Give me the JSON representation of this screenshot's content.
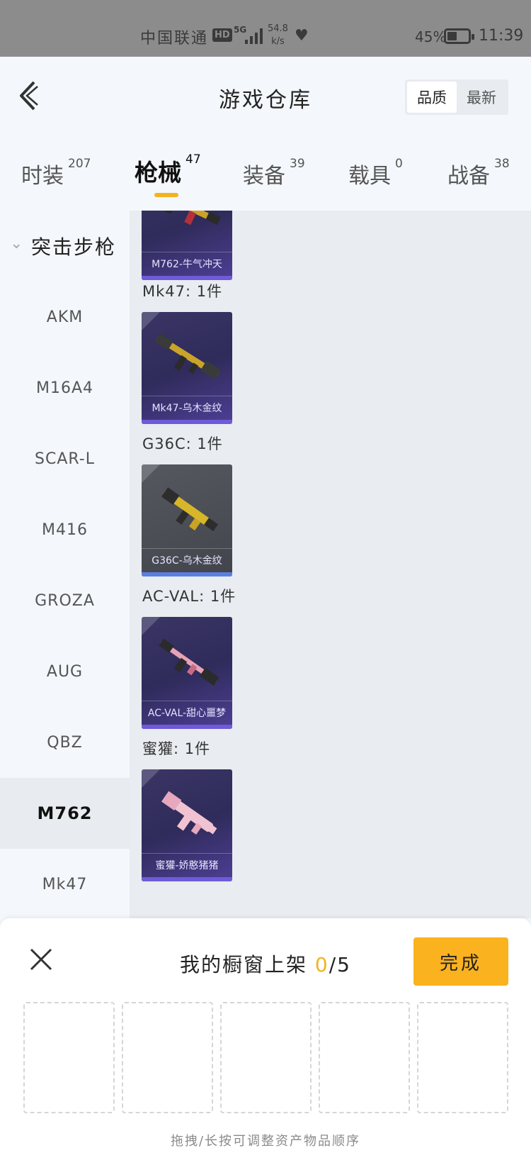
{
  "status_bar": {
    "carrier": "中国联通",
    "hd": "HD",
    "network": "5G",
    "speed_value": "54.8",
    "speed_unit": "k/s",
    "battery": "45%",
    "time": "11:39"
  },
  "header": {
    "title": "游戏仓库",
    "sort_options": [
      "品质",
      "最新"
    ],
    "sort_active": "品质"
  },
  "tabs": [
    {
      "label": "时装",
      "count": "207"
    },
    {
      "label": "枪械",
      "count": "47"
    },
    {
      "label": "装备",
      "count": "39"
    },
    {
      "label": "载具",
      "count": "0"
    },
    {
      "label": "战备",
      "count": "38"
    }
  ],
  "active_tab": "枪械",
  "sidebar": {
    "group_label": "突击步枪",
    "items": [
      "AKM",
      "M16A4",
      "SCAR-L",
      "M416",
      "GROZA",
      "AUG",
      "QBZ",
      "M762",
      "Mk47"
    ],
    "active_item": "M762"
  },
  "content": {
    "top_card": {
      "caption": "M762-牛气冲天",
      "color": "purple"
    },
    "groups": [
      {
        "label": "Mk47: 1件",
        "caption": "Mk47-乌木金纹",
        "color": "purple"
      },
      {
        "label": "G36C: 1件",
        "caption": "G36C-乌木金纹",
        "color": "grey"
      },
      {
        "label": "AC-VAL: 1件",
        "caption": "AC-VAL-甜心噩梦",
        "color": "purple"
      },
      {
        "label": "蜜獾: 1件",
        "caption": "蜜獾-娇憨猪猪",
        "color": "purple"
      }
    ]
  },
  "panel": {
    "title_text": "我的橱窗上架",
    "current": "0",
    "total": "/5",
    "done_label": "完成",
    "slots": 5,
    "hint": "拖拽/长按可调整资产物品顺序"
  },
  "colors": {
    "accent": "#f2b320",
    "done_button": "#fbb21f",
    "card_purple": "#3a3565",
    "card_grey": "#55585f"
  }
}
